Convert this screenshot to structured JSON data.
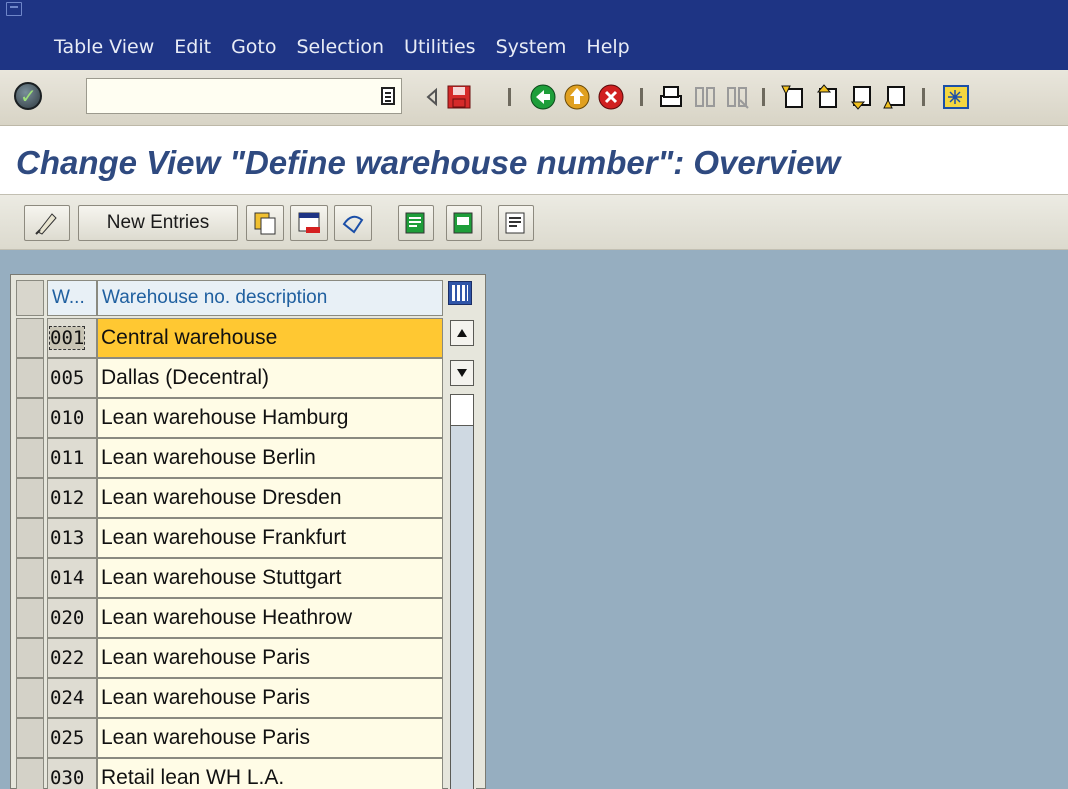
{
  "menu": {
    "items": [
      {
        "label": "Table View"
      },
      {
        "label": "Edit"
      },
      {
        "label": "Goto"
      },
      {
        "label": "Selection"
      },
      {
        "label": "Utilities"
      },
      {
        "label": "System"
      },
      {
        "label": "Help"
      }
    ]
  },
  "toolbar": {
    "command_value": "",
    "icons": [
      "enter-icon",
      "command-history-icon",
      "back-arrow-icon",
      "save-icon",
      "back-icon",
      "exit-icon",
      "cancel-icon",
      "print-icon",
      "find-icon",
      "find-next-icon",
      "first-page-icon",
      "previous-page-icon",
      "next-page-icon",
      "last-page-icon",
      "create-session-icon"
    ]
  },
  "page": {
    "title": "Change View \"Define warehouse number\": Overview"
  },
  "app_toolbar": {
    "new_entries_label": "New Entries",
    "icons": [
      "display-change-icon",
      "copy-as-icon",
      "delete-icon",
      "undo-change-icon",
      "select-all-icon",
      "select-block-icon",
      "deselect-all-icon"
    ]
  },
  "table": {
    "columns": [
      "W...",
      "Warehouse no. description"
    ],
    "rows": [
      {
        "code": "001",
        "desc": "Central warehouse"
      },
      {
        "code": "005",
        "desc": "Dallas (Decentral)"
      },
      {
        "code": "010",
        "desc": "Lean warehouse Hamburg"
      },
      {
        "code": "011",
        "desc": "Lean warehouse Berlin"
      },
      {
        "code": "012",
        "desc": "Lean warehouse Dresden"
      },
      {
        "code": "013",
        "desc": "Lean warehouse Frankfurt"
      },
      {
        "code": "014",
        "desc": "Lean warehouse Stuttgart"
      },
      {
        "code": "020",
        "desc": "Lean warehouse Heathrow"
      },
      {
        "code": "022",
        "desc": "Lean warehouse Paris"
      },
      {
        "code": "024",
        "desc": "Lean warehouse Paris"
      },
      {
        "code": "025",
        "desc": "Lean warehouse Paris"
      },
      {
        "code": "030",
        "desc": "Retail lean WH L.A."
      }
    ],
    "selected_index": 0
  },
  "colors": {
    "title_bar": "#1e3484",
    "heading": "#2f4a80",
    "work_area": "#96aec0",
    "selected_row": "#ffc832"
  }
}
